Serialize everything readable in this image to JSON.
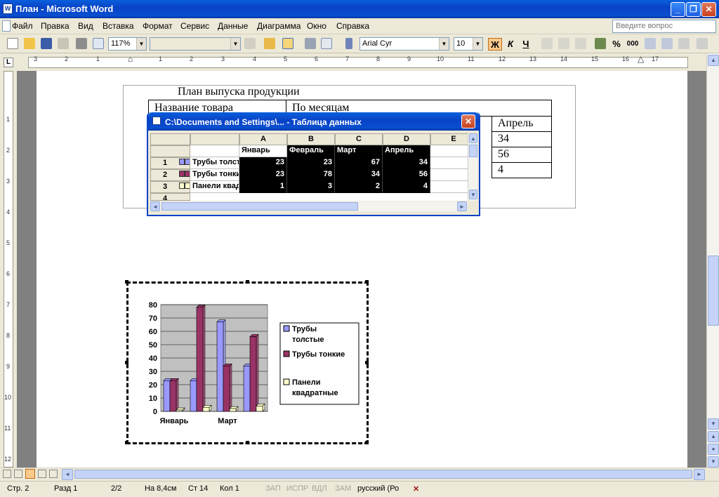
{
  "window": {
    "title": "План - Microsoft Word",
    "app_icon": "word-icon",
    "caption_buttons": [
      "_",
      "❐",
      "✕"
    ]
  },
  "menu": {
    "items": [
      "Файл",
      "Правка",
      "Вид",
      "Вставка",
      "Формат",
      "Сервис",
      "Данные",
      "Диаграмма",
      "Окно",
      "Справка"
    ],
    "ask_placeholder": "Введите вопрос"
  },
  "toolbar": {
    "zoom": "117%",
    "font": "Arial Cyr",
    "size": "10",
    "bold": "Ж",
    "italic": "К",
    "underline": "Ч"
  },
  "document": {
    "heading": "План выпуска продукции",
    "col1_header": "Название товара",
    "col2_header": "По месяцам",
    "april_header": "Апрель",
    "april_values": [
      "34",
      "56",
      "4"
    ]
  },
  "datasheet": {
    "title": "C:\\Documents and Settings\\... - Таблица данных",
    "columns": [
      "A",
      "B",
      "C",
      "D",
      "E"
    ],
    "months": [
      "Январь",
      "Февраль",
      "Март",
      "Апрель"
    ],
    "rows": [
      {
        "num": "1",
        "name": "Трубы толстые",
        "values": [
          "23",
          "23",
          "67",
          "34"
        ]
      },
      {
        "num": "2",
        "name": "Трубы тонкие",
        "values": [
          "23",
          "78",
          "34",
          "56"
        ]
      },
      {
        "num": "3",
        "name": "Панели квадратные",
        "values": [
          "1",
          "3",
          "2",
          "4"
        ]
      },
      {
        "num": "4",
        "name": "",
        "values": []
      }
    ]
  },
  "chart_data": {
    "type": "bar",
    "categories": [
      "Январь",
      "Февраль",
      "Март",
      "Апрель"
    ],
    "tick_labels_shown": [
      "Январь",
      "Март"
    ],
    "series": [
      {
        "name": "Трубы толстые",
        "values": [
          23,
          23,
          67,
          34
        ],
        "color": "#9999ff"
      },
      {
        "name": "Трубы тонкие",
        "values": [
          23,
          78,
          34,
          56
        ],
        "color": "#993366"
      },
      {
        "name": "Панели квадратные",
        "values": [
          1,
          3,
          2,
          4
        ],
        "color": "#ffffcc"
      }
    ],
    "ylim": [
      0,
      80
    ],
    "yticks": [
      "80",
      "70",
      "60",
      "50",
      "40",
      "30",
      "20",
      "10",
      "0"
    ],
    "legend_lines": [
      [
        "Трубы",
        "толстые"
      ],
      [
        "Трубы тонкие"
      ],
      [
        "Панели",
        "квадратные"
      ]
    ],
    "grid": true,
    "legend": "right",
    "plot_bg": "#c0c0c0"
  },
  "statusbar": {
    "page": "Стр. 2",
    "section": "Разд 1",
    "pages": "2/2",
    "at": "На 8,4см",
    "line": "Ст 14",
    "col": "Кол 1",
    "rec": "ЗАП",
    "trk": "ИСПР",
    "ext": "ВДЛ",
    "ovr": "ЗАМ",
    "lang": "русский (Ро"
  }
}
